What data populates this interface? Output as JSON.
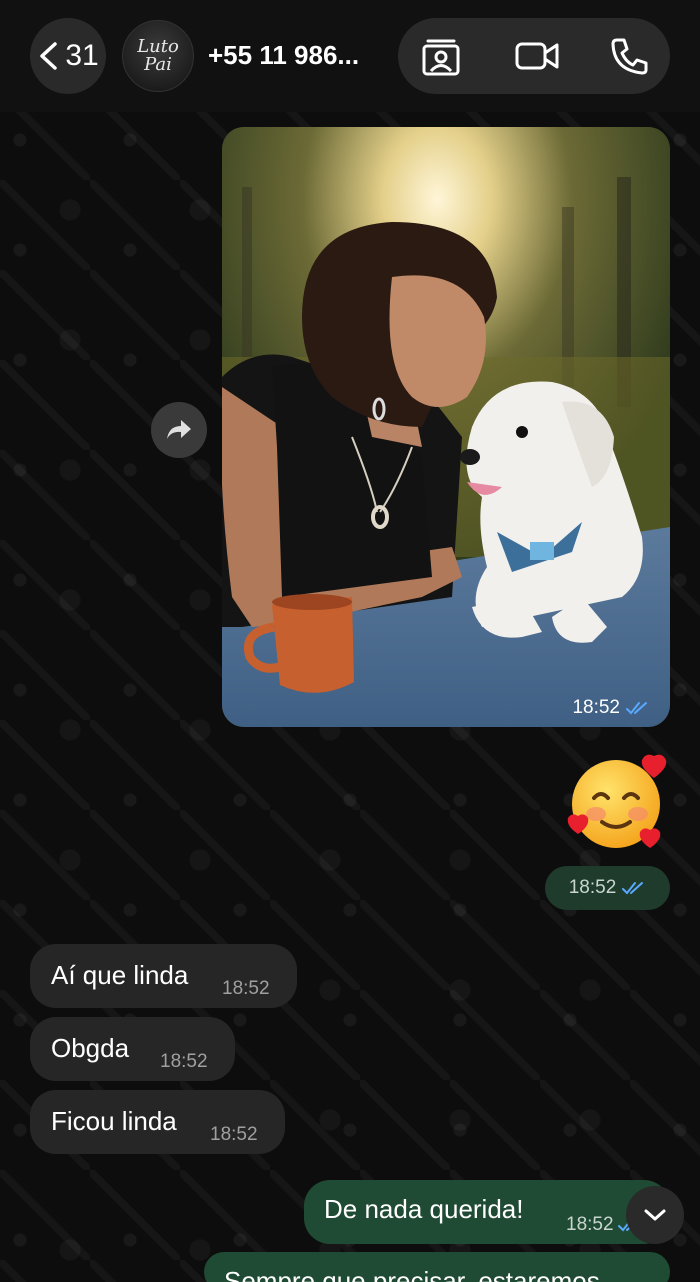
{
  "header": {
    "unread_count": "31",
    "avatar_text_line1": "Luto",
    "avatar_text_line2": "Pai",
    "contact_name": "+55 11 986...",
    "icons": [
      "chevron-left-icon",
      "contact-card-icon",
      "video-call-icon",
      "phone-icon"
    ]
  },
  "messages": [
    {
      "type": "image",
      "direction": "out",
      "time": "18:52",
      "status": "read"
    },
    {
      "type": "emoji",
      "direction": "out",
      "emoji": "🥰",
      "time": "18:52",
      "status": "read"
    },
    {
      "type": "text",
      "direction": "in",
      "text": "Aí que linda",
      "time": "18:52"
    },
    {
      "type": "text",
      "direction": "in",
      "text": "Obgda",
      "time": "18:52"
    },
    {
      "type": "text",
      "direction": "in",
      "text": "Ficou linda",
      "time": "18:52"
    },
    {
      "type": "text",
      "direction": "out",
      "text": "De nada querida!",
      "time": "18:52",
      "status": "read"
    },
    {
      "type": "text",
      "direction": "out",
      "text": "Sempre que precisar, estaremos",
      "time": "",
      "status": ""
    }
  ],
  "colors": {
    "outgoing_bubble": "#1f4a33",
    "incoming_bubble": "#262626",
    "read_tick": "#5aa9ff",
    "background": "#0d0d0d"
  }
}
